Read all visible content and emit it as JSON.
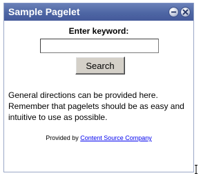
{
  "pagelet": {
    "title": "Sample Pagelet",
    "icons": {
      "minimize": "minimize-icon",
      "close": "close-icon"
    },
    "keyword_label": "Enter keyword:",
    "keyword_input": {
      "value": "",
      "placeholder": ""
    },
    "search_button_label": "Search",
    "directions": "General directions can be provided here. Remember that pagelets should be as easy and intuitive to use as possible.",
    "provided_by": {
      "prefix": "Provided by",
      "link_text": "Content Source Company"
    }
  },
  "colors": {
    "titlebar": "#4e66a4",
    "title_text": "#ffffff",
    "link": "#0000ee"
  }
}
